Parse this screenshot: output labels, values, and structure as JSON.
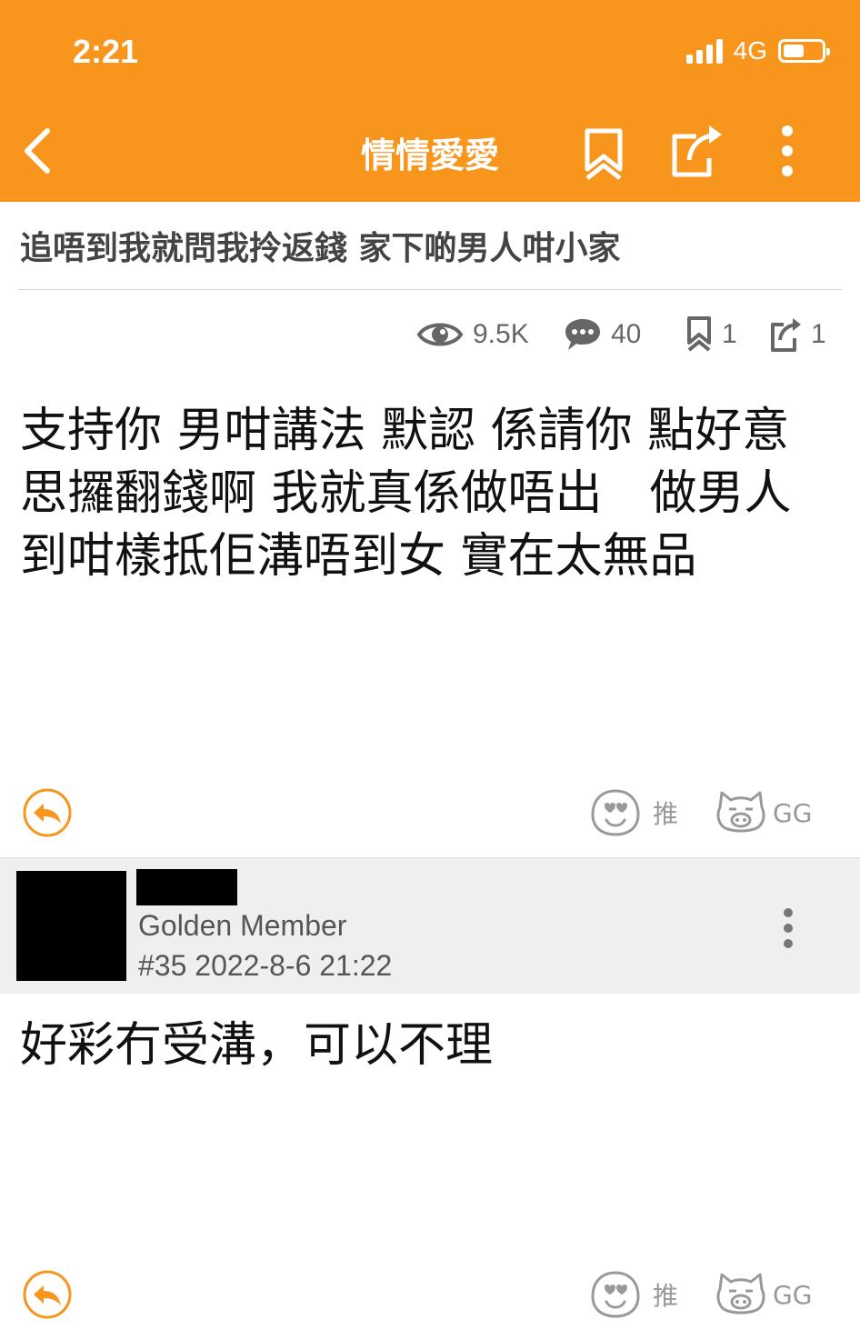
{
  "status_bar": {
    "time": "2:21",
    "network": "4G"
  },
  "nav": {
    "title": "情情愛愛",
    "back_icon": "chevron-left-icon",
    "bookmark_icon": "bookmark-icon",
    "share_icon": "share-icon",
    "more_icon": "more-vertical-icon"
  },
  "thread": {
    "title": "追唔到我就問我拎返錢 家下啲男人咁小家",
    "stats": {
      "views": "9.5K",
      "comments": "40",
      "bookmarks": "1",
      "shares": "1"
    }
  },
  "posts": [
    {
      "body": "支持你 男咁講法 默認 係請你 點好意思攞翻錢啊 我就真係做唔出　做男人到咁樣抵佢溝唔到女 實在太無品",
      "push_label": "推",
      "gg_label": "GG"
    },
    {
      "member_level": "Golden Member",
      "meta": "#35 2022-8-6 21:22",
      "body": "好彩冇受溝，可以不理",
      "push_label": "推",
      "gg_label": "GG"
    }
  ],
  "colors": {
    "brand": "#f7951d",
    "header_bg": "#efefef"
  }
}
